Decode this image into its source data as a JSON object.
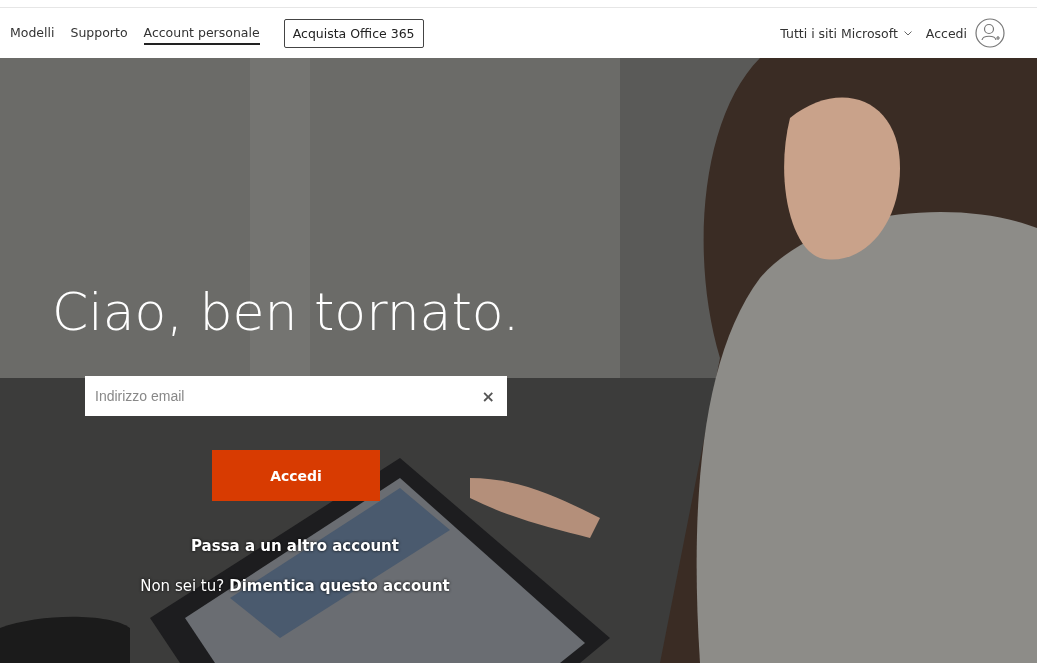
{
  "nav": {
    "links": [
      {
        "label": "Modelli",
        "selected": false
      },
      {
        "label": "Supporto",
        "selected": false
      },
      {
        "label": "Account personale",
        "selected": true
      }
    ],
    "buy_button": "Acquista Office 365",
    "all_sites": "Tutti i siti Microsoft",
    "sign_in": "Accedi"
  },
  "hero": {
    "kind": "picture",
    "heading": "Ciao, ben tornato.",
    "email_field": {
      "placeholder": "Indirizzo email",
      "clear": "×"
    },
    "submit_button": "Accedi",
    "switch_link": "Passa a un altro account",
    "prompt": "Non sei tu?",
    "forget_link": "Dimentica questo account"
  }
}
